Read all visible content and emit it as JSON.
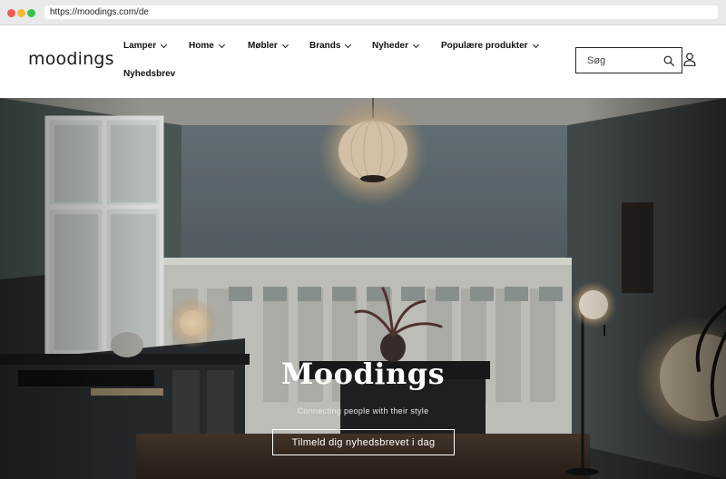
{
  "browser": {
    "url": "https://moodings.com/de"
  },
  "header": {
    "logo_text": "moodings",
    "nav": [
      {
        "label": "Lamper",
        "has_dropdown": true
      },
      {
        "label": "Home",
        "has_dropdown": true
      },
      {
        "label": "Møbler",
        "has_dropdown": true
      },
      {
        "label": "Brands",
        "has_dropdown": true
      },
      {
        "label": "Nyheder",
        "has_dropdown": true
      },
      {
        "label": "Populære produkter",
        "has_dropdown": true
      },
      {
        "label": "Nyhedsbrev",
        "has_dropdown": false
      }
    ],
    "search": {
      "placeholder": "Søg",
      "icon": "search-icon"
    },
    "account_icon": "user-icon"
  },
  "hero": {
    "title": "Moodings",
    "subtitle": "Connecting people with their style",
    "cta_label": "Tilmeld dig nyhedsbrevet i dag"
  }
}
